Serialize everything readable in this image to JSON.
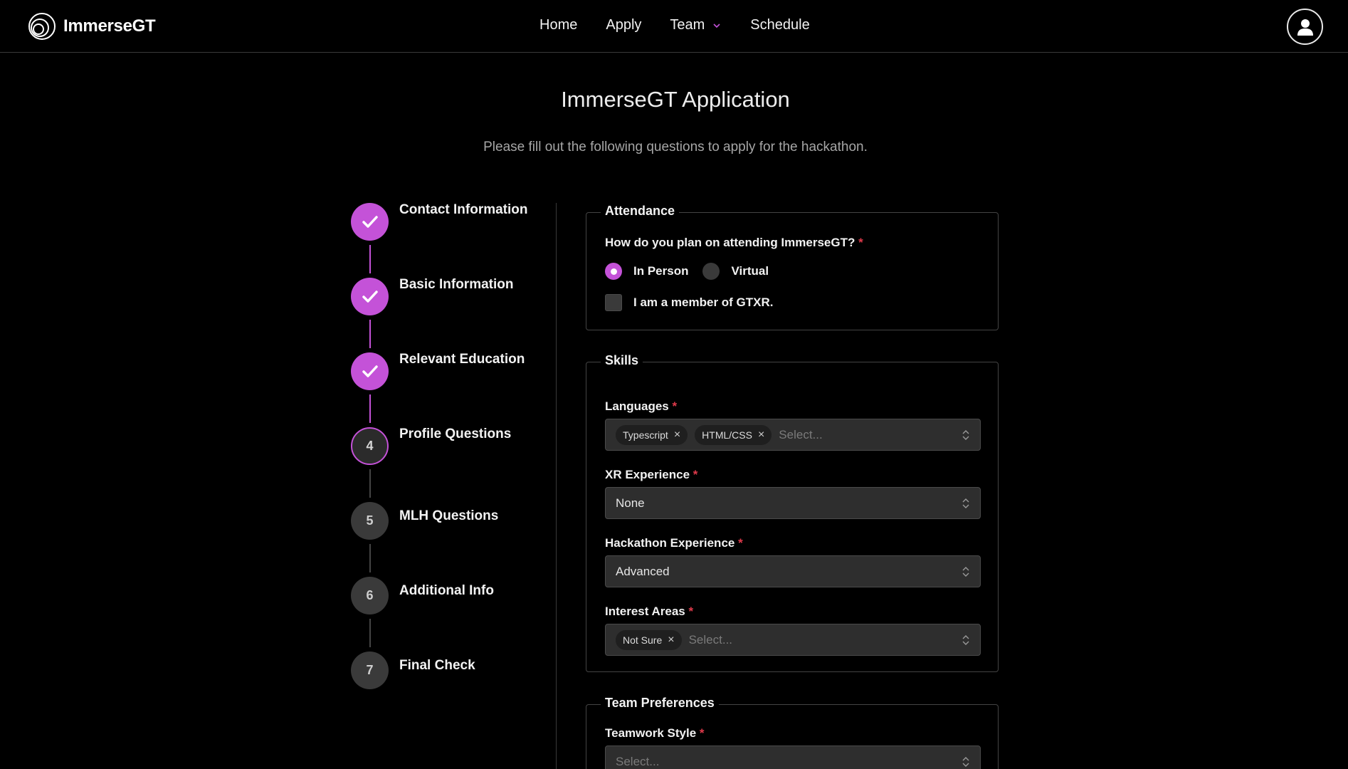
{
  "header": {
    "brand": "ImmerseGT",
    "nav": [
      {
        "label": "Home"
      },
      {
        "label": "Apply"
      },
      {
        "label": "Team"
      },
      {
        "label": "Schedule"
      }
    ]
  },
  "page": {
    "title": "ImmerseGT Application",
    "subtitle": "Please fill out the following questions to apply for the hackathon."
  },
  "stepper": {
    "steps": [
      {
        "number": "1",
        "label": "Contact Information",
        "status": "done"
      },
      {
        "number": "2",
        "label": "Basic Information",
        "status": "done"
      },
      {
        "number": "3",
        "label": "Relevant Education",
        "status": "done"
      },
      {
        "number": "4",
        "label": "Profile Questions",
        "status": "current"
      },
      {
        "number": "5",
        "label": "MLH Questions",
        "status": "todo"
      },
      {
        "number": "6",
        "label": "Additional Info",
        "status": "todo"
      },
      {
        "number": "7",
        "label": "Final Check",
        "status": "todo"
      }
    ]
  },
  "attendance": {
    "legend": "Attendance",
    "question": "How do you plan on attending ImmerseGT?",
    "required_mark": "*",
    "options": [
      {
        "label": "In Person",
        "selected": true
      },
      {
        "label": "Virtual",
        "selected": false
      }
    ],
    "member_checkbox": {
      "label": "I am a member of GTXR.",
      "checked": false
    }
  },
  "skills": {
    "legend": "Skills",
    "languages": {
      "label": "Languages",
      "tags": [
        "Typescript",
        "HTML/CSS"
      ],
      "placeholder": "Select..."
    },
    "xr_experience": {
      "label": "XR Experience",
      "value": "None"
    },
    "hackathon_experience": {
      "label": "Hackathon Experience",
      "value": "Advanced"
    },
    "interest_areas": {
      "label": "Interest Areas",
      "tags": [
        "Not Sure"
      ],
      "placeholder": "Select..."
    }
  },
  "team_preferences": {
    "legend": "Team Preferences",
    "teamwork_style": {
      "label": "Teamwork Style",
      "placeholder": "Select..."
    }
  },
  "colors": {
    "accent": "#c452d8",
    "required": "#e03a4b",
    "background": "#000000"
  }
}
